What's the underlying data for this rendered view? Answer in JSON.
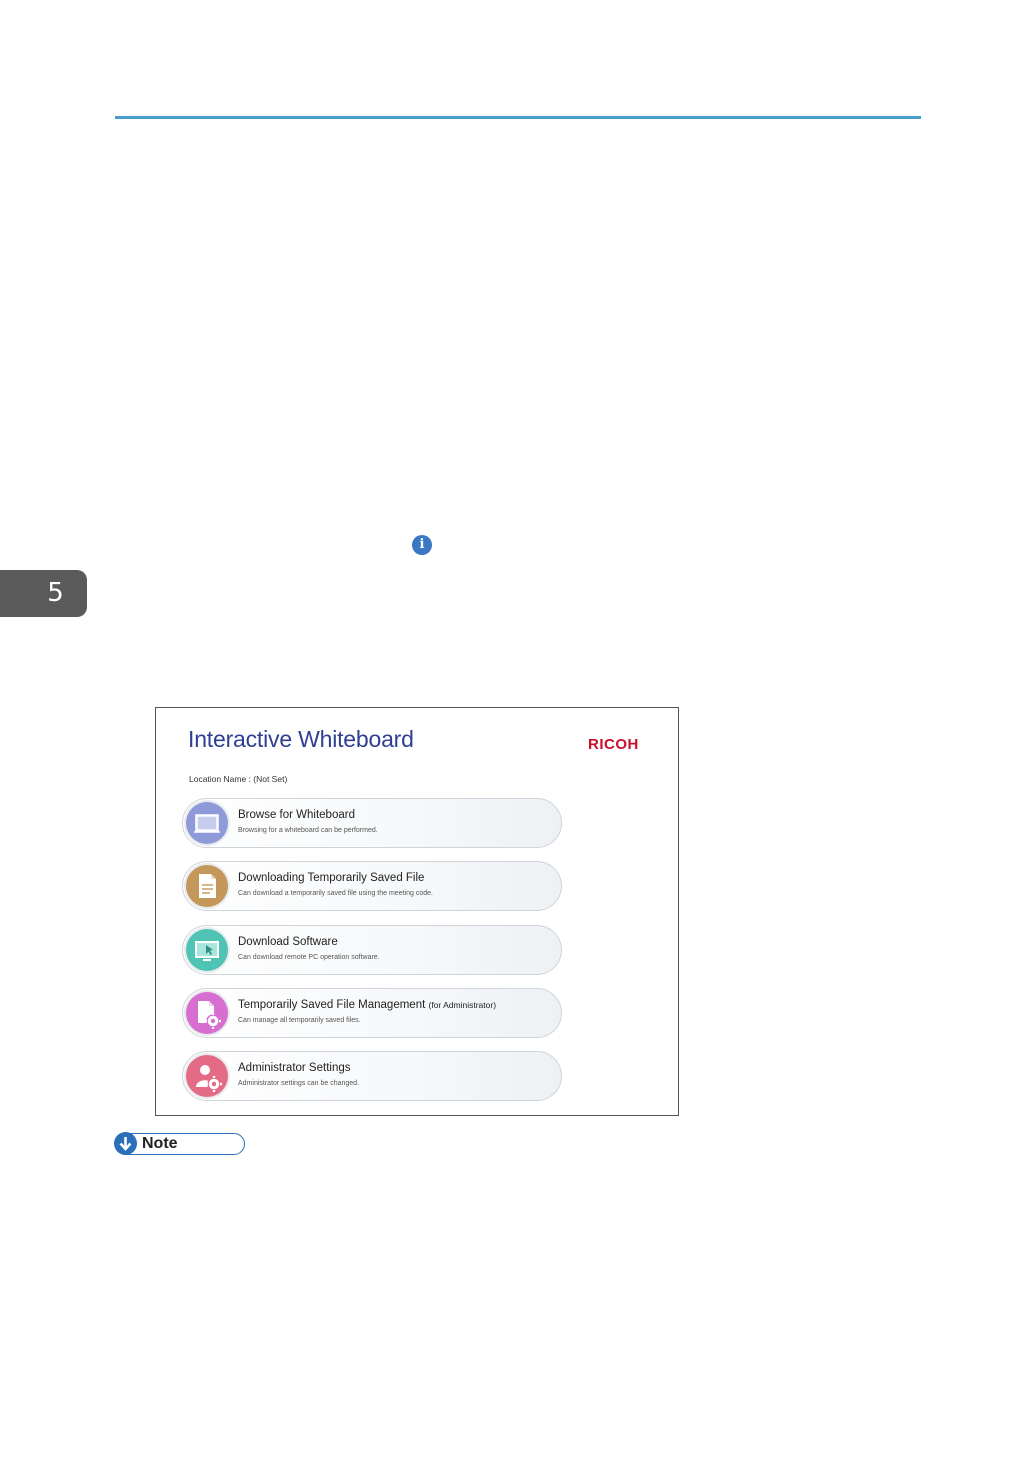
{
  "chapter": {
    "number": "5"
  },
  "info_icon": {
    "glyph": "i",
    "color": "#3b78c4"
  },
  "app": {
    "title": "Interactive Whiteboard",
    "brand": "RICOH",
    "location_label": "Location Name : ",
    "location_value": "(Not Set)",
    "menu": [
      {
        "title": "Browse for Whiteboard",
        "suffix": "",
        "desc": "Browsing for a whiteboard can be performed.",
        "icon": "whiteboard-icon",
        "color": "#8f9bd8"
      },
      {
        "title": "Downloading Temporarily Saved File",
        "suffix": "",
        "desc": "Can download a temporarily saved file using the meeting code.",
        "icon": "document-icon",
        "color": "#c4975a"
      },
      {
        "title": "Download Software",
        "suffix": "",
        "desc": "Can download remote PC operation software.",
        "icon": "monitor-cursor-icon",
        "color": "#4fc4b4"
      },
      {
        "title": "Temporarily Saved File Management ",
        "suffix": "(for Administrator)",
        "desc": "Can manage all temporarily saved files.",
        "icon": "file-gear-icon",
        "color": "#d66fcf"
      },
      {
        "title": "Administrator Settings",
        "suffix": "",
        "desc": "Administrator settings can be changed.",
        "icon": "user-gear-icon",
        "color": "#e36b86"
      }
    ]
  },
  "note": {
    "label": "Note"
  },
  "colors": {
    "rule": "#4a9fd0",
    "title": "#2e3f93",
    "brand": "#c8102e",
    "note": "#2a6fb7"
  }
}
